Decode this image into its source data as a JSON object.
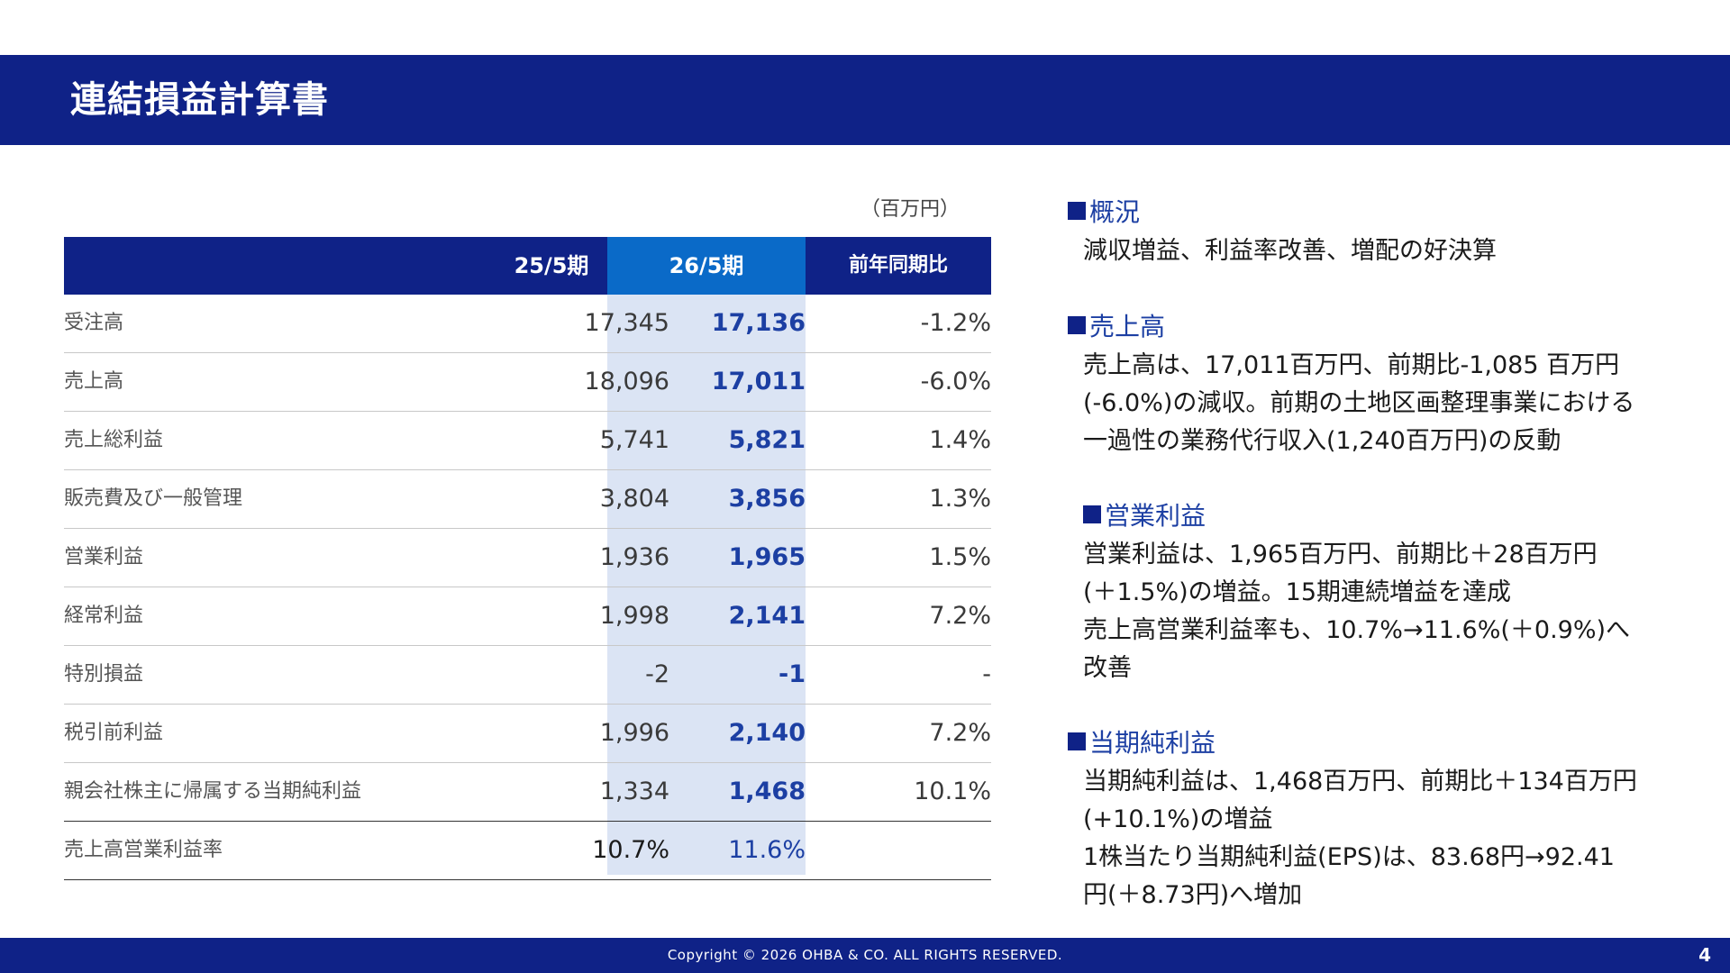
{
  "header": {
    "title": "連結損益計算書"
  },
  "table": {
    "unit": "（百万円）",
    "columns": {
      "prev": "25/5期",
      "curr": "26/5期",
      "yoy": "前年同期比"
    },
    "rows": [
      {
        "label": "受注高",
        "prev": "17,345",
        "curr": "17,136",
        "yoy": "-1.2%"
      },
      {
        "label": "売上高",
        "prev": "18,096",
        "curr": "17,011",
        "yoy": "-6.0%"
      },
      {
        "label": "売上総利益",
        "prev": "5,741",
        "curr": "5,821",
        "yoy": "1.4%"
      },
      {
        "label": "販売費及び一般管理",
        "prev": "3,804",
        "curr": "3,856",
        "yoy": "1.3%"
      },
      {
        "label": "営業利益",
        "prev": "1,936",
        "curr": "1,965",
        "yoy": "1.5%"
      },
      {
        "label": "経常利益",
        "prev": "1,998",
        "curr": "2,141",
        "yoy": "7.2%"
      },
      {
        "label": "特別損益",
        "prev": "-2",
        "curr": "-1",
        "yoy": "-"
      },
      {
        "label": "税引前利益",
        "prev": "1,996",
        "curr": "2,140",
        "yoy": "7.2%"
      },
      {
        "label": "親会社株主に帰属する当期純利益",
        "prev": "1,334",
        "curr": "1,468",
        "yoy": "10.1%"
      }
    ],
    "margin_row": {
      "label": "売上高営業利益率",
      "prev": "10.7%",
      "curr": "11.6%"
    }
  },
  "summary": {
    "overview": {
      "title": "概況",
      "lines": [
        "減収増益、利益率改善、増配の好決算"
      ]
    },
    "sales": {
      "title": "売上高",
      "lines": [
        "売上高は、17,011百万円、前期比-1,085 百万円",
        "(-6.0%)の減収。前期の土地区画整理事業における",
        "一過性の業務代行収入(1,240百万円)の反動"
      ]
    },
    "operating": {
      "title": "営業利益",
      "lines": [
        "営業利益は、1,965百万円、前期比＋28百万円",
        "(＋1.5%)の増益。15期連続増益を達成",
        "売上高営業利益率も、10.7%→11.6%(＋0.9%)へ",
        "改善"
      ]
    },
    "net": {
      "title": "当期純利益",
      "lines": [
        "当期純利益は、1,468百万円、前期比＋134百万円",
        "(+10.1%)の増益",
        "1株当たり当期純利益(EPS)は、83.68円→92.41",
        "円(＋8.73円)へ増加"
      ]
    }
  },
  "footer": {
    "copyright": "Copyright © 2026 OHBA & CO. ALL RIGHTS RESERVED.",
    "page": "4"
  },
  "colors": {
    "brand": "#0f2287",
    "accent": "#0a6ac8",
    "highlight_band": "#dbe4f4",
    "value_text": "#1c3fa3"
  }
}
